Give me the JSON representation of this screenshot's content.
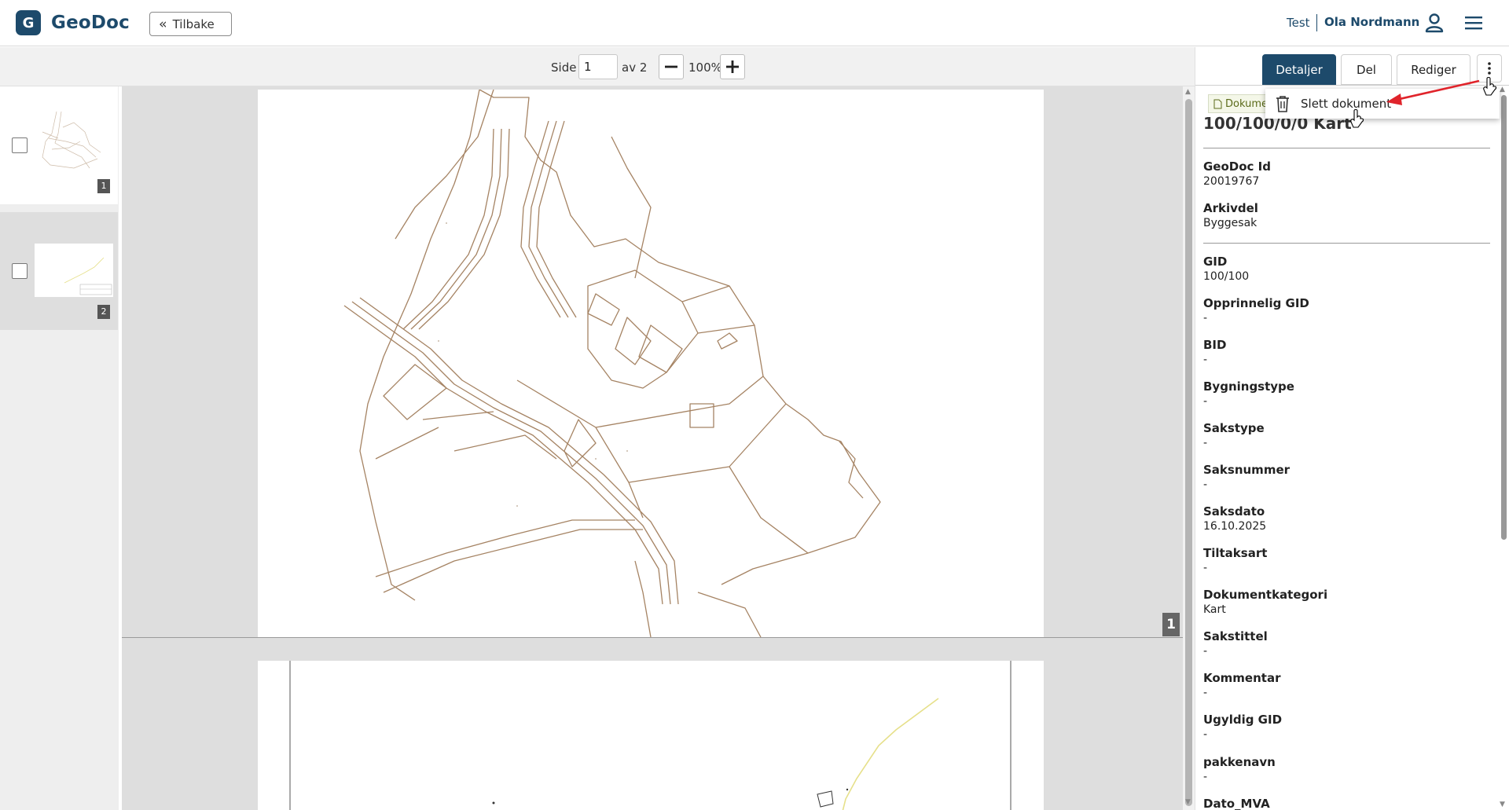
{
  "app": {
    "logo_letter": "G",
    "name": "GeoDoc",
    "back_label": "Tilbake",
    "environment": "Test",
    "user_name": "Ola Nordmann"
  },
  "toolbar": {
    "page_label": "Side",
    "page_value": "1",
    "page_total": "av 2",
    "zoom": "100%"
  },
  "thumbnails": [
    {
      "number": "1",
      "checked": false
    },
    {
      "number": "2",
      "checked": false
    }
  ],
  "viewer": {
    "page_badge": "1"
  },
  "panel": {
    "tabs": [
      "Detaljer",
      "Del",
      "Rediger"
    ],
    "active_tab": "Detaljer",
    "doc_chip": "Dokumen",
    "doc_title": "100/100/0/0 Kart",
    "fields": [
      {
        "label": "GeoDoc Id",
        "value": "20019767"
      },
      {
        "label": "Arkivdel",
        "value": "Byggesak"
      },
      {
        "label": "GID",
        "value": "100/100"
      },
      {
        "label": "Opprinnelig GID",
        "value": "-"
      },
      {
        "label": "BID",
        "value": "-"
      },
      {
        "label": "Bygningstype",
        "value": "-"
      },
      {
        "label": "Sakstype",
        "value": "-"
      },
      {
        "label": "Saksnummer",
        "value": "-"
      },
      {
        "label": "Saksdato",
        "value": "16.10.2025"
      },
      {
        "label": "Tiltaksart",
        "value": "-"
      },
      {
        "label": "Dokumentkategori",
        "value": "Kart"
      },
      {
        "label": "Sakstittel",
        "value": "-"
      },
      {
        "label": "Kommentar",
        "value": "-"
      },
      {
        "label": "Ugyldig GID",
        "value": "-"
      },
      {
        "label": "pakkenavn",
        "value": "-"
      },
      {
        "label": "Dato_MVA",
        "value": ""
      }
    ]
  },
  "dropdown": {
    "delete_label": "Slett dokument"
  },
  "colors": {
    "brand": "#1d4a6b",
    "map_line": "#a58363",
    "annotation_arrow": "#e0242b"
  },
  "icons": {
    "back": "double-chevron-left-icon",
    "user": "person-icon",
    "menu": "hamburger-menu-icon",
    "zoom_out": "minus-icon",
    "zoom_in": "plus-icon",
    "more": "vertical-dots-icon",
    "delete": "trash-icon",
    "document": "document-icon"
  }
}
